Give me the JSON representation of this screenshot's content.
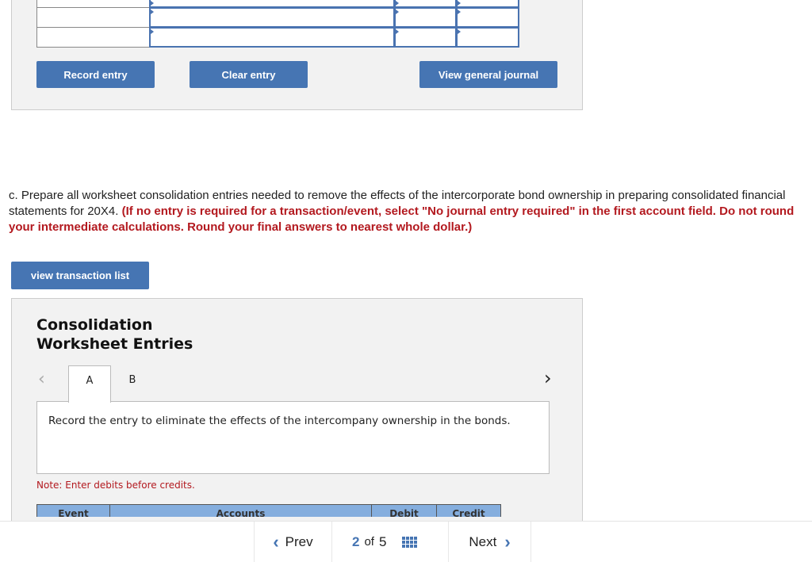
{
  "journal": {
    "record_label": "Record entry",
    "clear_label": "Clear entry",
    "view_label": "View general journal"
  },
  "question": {
    "prefix": "c. Prepare all worksheet consolidation entries needed to remove the effects of the intercorporate bond ownership in preparing consolidated financial statements for 20X4. ",
    "instruction": "(If no entry is required for a transaction/event, select \"No journal entry required\" in the first account field. Do not round your intermediate calculations. Round your final answers to nearest whole dollar.)"
  },
  "transaction_list_label": "view transaction list",
  "worksheet": {
    "title_line1": "Consolidation",
    "title_line2": "Worksheet Entries",
    "tabs": [
      "A",
      "B"
    ],
    "active_tab": "A",
    "instruction": "Record the entry to eliminate the effects of the intercompany ownership in the bonds.",
    "note": "Note: Enter debits before credits.",
    "columns": [
      "Event",
      "Accounts",
      "Debit",
      "Credit"
    ]
  },
  "pager": {
    "prev": "Prev",
    "current": "2",
    "of": "of",
    "total": "5",
    "next": "Next"
  },
  "colors": {
    "accent": "#4675b3",
    "instruction_red": "#b3191f",
    "header_blue": "#85aede"
  }
}
